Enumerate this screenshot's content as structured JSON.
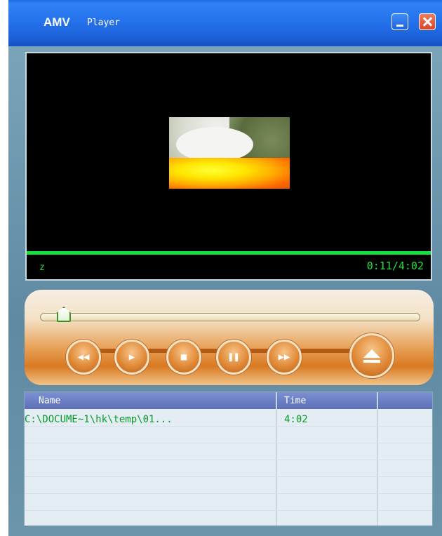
{
  "window": {
    "brand": "AMV",
    "title": "Player"
  },
  "titlebar": {
    "minimize": "minimize",
    "close": "close"
  },
  "video": {
    "status": "z",
    "time": "0:11/4:02",
    "progress_fraction": 0.045
  },
  "controls": {
    "seek_fraction": 0.045,
    "buttons": [
      "rewind",
      "play",
      "stop",
      "pause",
      "fast-forward",
      "eject"
    ]
  },
  "playlist": {
    "columns": [
      "Name",
      "Time"
    ],
    "rows": [
      {
        "name": "C:\\DOCUME~1\\hk\\temp\\01...",
        "time": "4:02"
      }
    ]
  },
  "colors": {
    "accent_green": "#20e040",
    "titlebar_blue": "#2470ea",
    "panel_orange": "#d97a22"
  }
}
